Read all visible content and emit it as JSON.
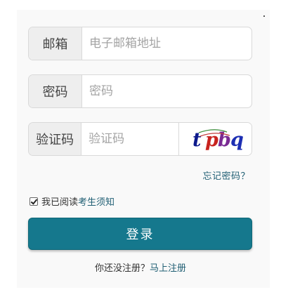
{
  "email": {
    "label": "邮箱",
    "placeholder": "电子邮箱地址"
  },
  "password": {
    "label": "密码",
    "placeholder": "密码"
  },
  "captcha": {
    "label": "验证码",
    "placeholder": "验证码",
    "image_text": "tpbq"
  },
  "forgot_password": "忘记密码？",
  "agreement": {
    "prefix": "我已阅读",
    "link": "考生须知",
    "checked": true
  },
  "login_button": "登录",
  "register": {
    "prompt": "你还没注册？",
    "link": "马上注册"
  },
  "colors": {
    "primary": "#15788d",
    "link": "#1f5e73",
    "addon_bg": "#eeeeee"
  }
}
